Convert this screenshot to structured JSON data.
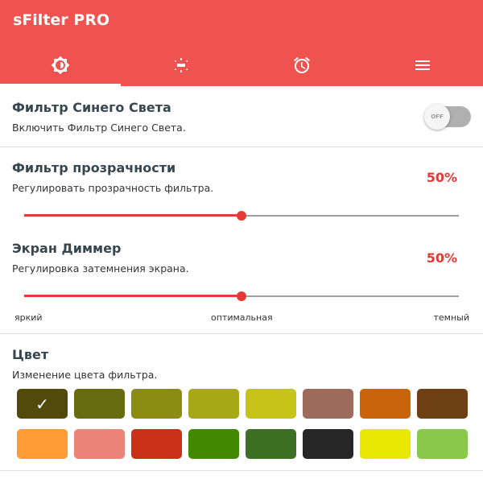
{
  "app": {
    "title": "sFilter PRO"
  },
  "tabs": [
    {
      "icon": "brightness-icon",
      "selected": true
    },
    {
      "icon": "dimmer-icon",
      "selected": false
    },
    {
      "icon": "alarm-clock-icon",
      "selected": false
    },
    {
      "icon": "menu-icon",
      "selected": false
    }
  ],
  "blue_filter": {
    "title": "Фильтр Синего Света",
    "subtitle": "Включить Фильтр Синего Света.",
    "toggle_label": "OFF",
    "enabled": false
  },
  "opacity_filter": {
    "title": "Фильтр прозрачности",
    "subtitle": "Регулировать прозрачность фильтра.",
    "value_label": "50%",
    "value": 0.5
  },
  "screen_dimmer": {
    "title": "Экран Диммер",
    "subtitle": "Регулировка затемнения экрана.",
    "value_label": "50%",
    "value": 0.5,
    "scale": {
      "left": "яркий",
      "center": "оптимальная",
      "right": "темный"
    }
  },
  "color": {
    "title": "Цвет",
    "subtitle": "Изменение цвета фильтра.",
    "selected_index": 0,
    "swatches": [
      "#514a0a",
      "#686a0e",
      "#8a8d12",
      "#a7a816",
      "#c6c419",
      "#9e6a5c",
      "#c9640a",
      "#6e3f12",
      "#fd9c35",
      "#ea8478",
      "#c93218",
      "#418a00",
      "#3c7125",
      "#262626",
      "#e8e800",
      "#8ac84b"
    ]
  },
  "colors": {
    "accent": "#ef5350",
    "slider": "#e53935"
  }
}
